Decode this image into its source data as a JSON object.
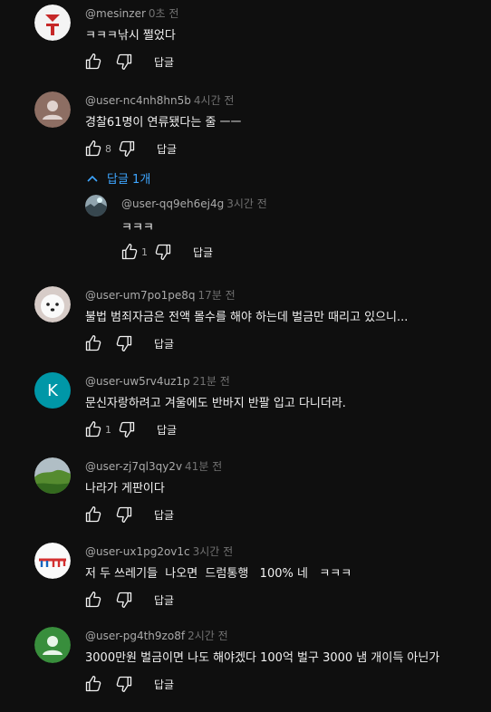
{
  "comments": [
    {
      "author": "@mesinzer",
      "time": "0초 전",
      "text": "ㅋㅋㅋ낚시 쩔었다",
      "likes": "",
      "reply_label": "답글",
      "avatar_text": ""
    },
    {
      "author": "@user-nc4nh8hn5b",
      "time": "4시간 전",
      "text": "경찰61명이 연류됐다는 줄 ㅡㅡ",
      "likes": "8",
      "reply_label": "답글",
      "avatar_text": ""
    },
    {
      "author": "@user-um7po1pe8q",
      "time": "17분 전",
      "text": "불법 범죄자금은 전액 몰수를 해야 하는데 벌금만 때리고 있으니...",
      "likes": "",
      "reply_label": "답글",
      "avatar_text": ""
    },
    {
      "author": "@user-uw5rv4uz1p",
      "time": "21분 전",
      "text": "문신자랑하려고 겨울에도 반바지 반팔 입고 다니더라.",
      "likes": "1",
      "reply_label": "답글",
      "avatar_text": "K"
    },
    {
      "author": "@user-zj7ql3qy2v",
      "time": "41분 전",
      "text": "나라가 게판이다",
      "likes": "",
      "reply_label": "답글",
      "avatar_text": ""
    },
    {
      "author": "@user-ux1pg2ov1c",
      "time": "3시간 전",
      "text": "저 두 쓰레기들  나오면  드럼통행   100% 네   ㅋㅋㅋ",
      "likes": "",
      "reply_label": "답글",
      "avatar_text": ""
    },
    {
      "author": "@user-pg4th9zo8f",
      "time": "2시간 전",
      "text": "3000만원 벌금이면 나도 해야겠다 100억 벌구 3000 냄 개이득 아닌가",
      "likes": "",
      "reply_label": "답글",
      "avatar_text": ""
    }
  ],
  "replies_toggle": {
    "label": "답글 1개"
  },
  "subcomment": {
    "author": "@user-qq9eh6ej4g",
    "time": "3시간 전",
    "text": "ㅋㅋㅋ",
    "likes": "1",
    "reply_label": "답글"
  },
  "colors": {
    "accent": "#3ea6ff",
    "background": "#0f0f0f",
    "avatar_k": "#0097a7"
  }
}
